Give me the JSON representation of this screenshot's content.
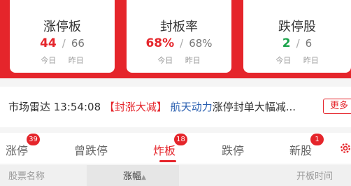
{
  "stats": [
    {
      "title": "涨停板",
      "today": "44",
      "sep": "/",
      "yesterday": "66",
      "sub": "今日 昨日"
    },
    {
      "title": "封板率",
      "today": "68%",
      "sep": "/",
      "yesterday": "68%",
      "sub": "今日 昨日"
    },
    {
      "title": "跌停股",
      "today": "2",
      "sep": "/",
      "yesterday": "6",
      "sub": "今日 昨日"
    }
  ],
  "radar": {
    "prefix": "市场雷达 13:54:08",
    "tag": "【封涨大减】",
    "stock": "航天动力",
    "text": "涨停封单大幅减...",
    "more": "更多"
  },
  "tabs": [
    {
      "label": "涨停",
      "badge": "39"
    },
    {
      "label": "曾跌停",
      "badge": ""
    },
    {
      "label": "炸板",
      "badge": "18"
    },
    {
      "label": "跌停",
      "badge": ""
    },
    {
      "label": "新股",
      "badge": "1"
    }
  ],
  "active_tab": "炸板",
  "columns": [
    "股票名称",
    "涨幅",
    "",
    "开板时间"
  ],
  "colors": {
    "accent": "#e5252b",
    "up": "#e5252b",
    "down": "#1aa34a",
    "link": "#2a5fb0"
  },
  "icons": {
    "settings": "gear-icon",
    "sort": "sort-triangle-icon"
  }
}
